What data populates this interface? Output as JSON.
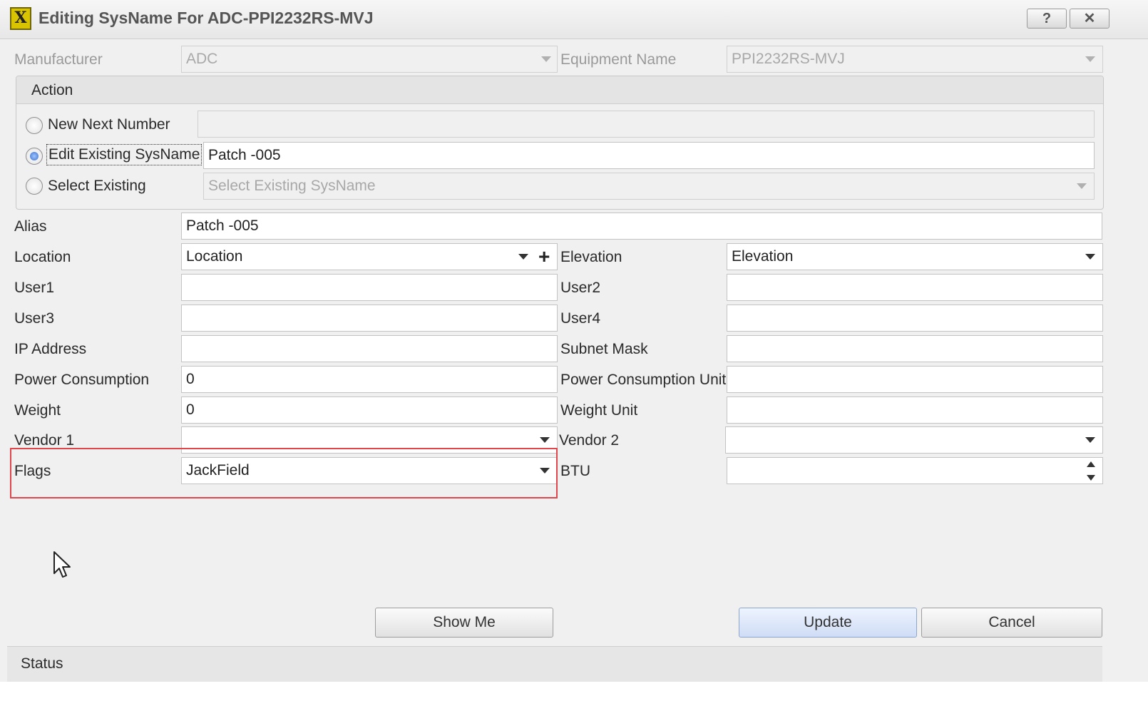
{
  "window": {
    "title": "Editing SysName For ADC-PPI2232RS-MVJ",
    "app_icon": "X",
    "help_label": "?",
    "close_label": "✕"
  },
  "header": {
    "manufacturer_label": "Manufacturer",
    "manufacturer_value": "ADC",
    "equipment_label": "Equipment Name",
    "equipment_value": "PPI2232RS-MVJ"
  },
  "action": {
    "title": "Action",
    "options": [
      {
        "label": "New Next Number",
        "selected": false,
        "value": ""
      },
      {
        "label": "Edit Existing SysName",
        "selected": true,
        "value": "Patch -005"
      },
      {
        "label": "Select Existing",
        "selected": false,
        "value": "Select Existing SysName"
      }
    ]
  },
  "fields": {
    "alias": {
      "label": "Alias",
      "value": "Patch -005"
    },
    "location": {
      "label": "Location",
      "value": "Location",
      "add_label": "+"
    },
    "elevation": {
      "label": "Elevation",
      "value": "Elevation"
    },
    "user1": {
      "label": "User1",
      "value": ""
    },
    "user2": {
      "label": "User2",
      "value": ""
    },
    "user3": {
      "label": "User3",
      "value": ""
    },
    "user4": {
      "label": "User4",
      "value": ""
    },
    "ip_address": {
      "label": "IP Address",
      "value": ""
    },
    "subnet_mask": {
      "label": "Subnet Mask",
      "value": ""
    },
    "power_consumption": {
      "label": "Power Consumption",
      "value": "0"
    },
    "power_consumption_unit": {
      "label": "Power Consumption Unit",
      "value": ""
    },
    "weight": {
      "label": "Weight",
      "value": "0"
    },
    "weight_unit": {
      "label": "Weight Unit",
      "value": ""
    },
    "vendor1": {
      "label": "Vendor 1",
      "value": ""
    },
    "vendor2": {
      "label": "Vendor 2",
      "value": ""
    },
    "flags": {
      "label": "Flags",
      "value": "JackField"
    },
    "btu": {
      "label": "BTU",
      "value": ""
    }
  },
  "buttons": {
    "show_me": "Show Me",
    "update": "Update",
    "cancel": "Cancel"
  },
  "status": {
    "text": "Status"
  },
  "colors": {
    "highlight": "#e0474c",
    "selected_radio": "#3a6fd0"
  }
}
